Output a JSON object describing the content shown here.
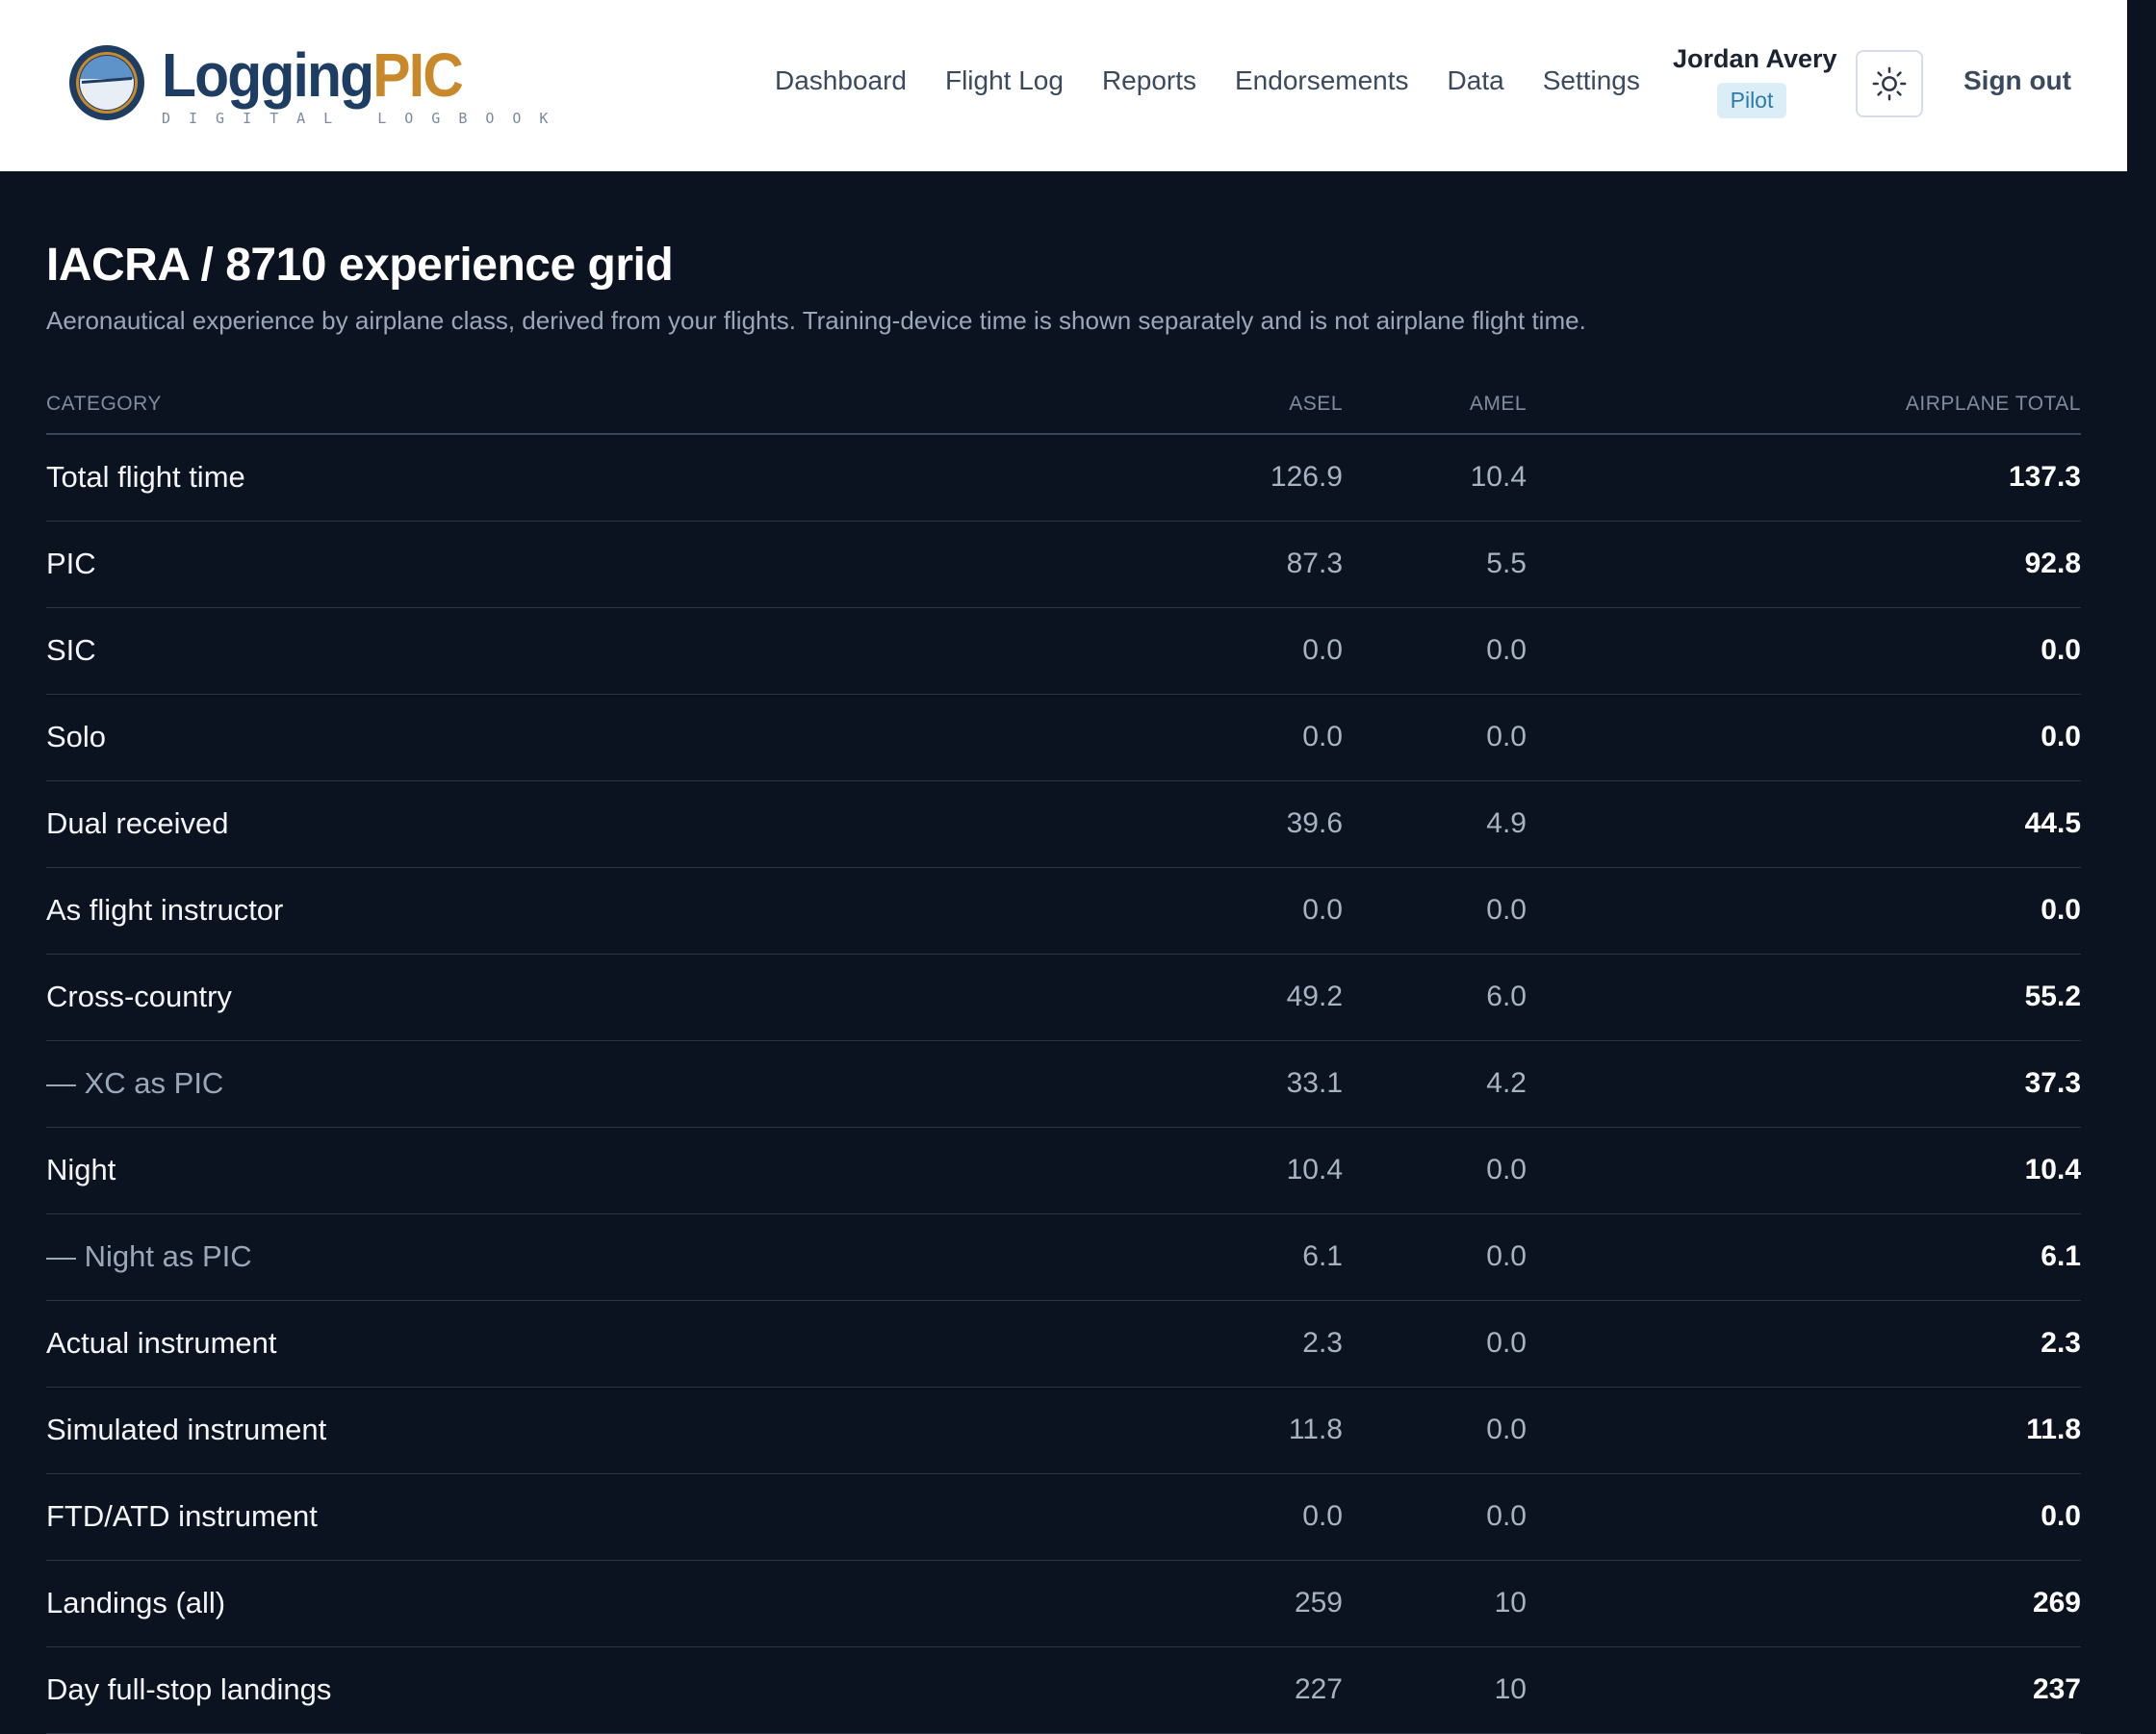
{
  "brand": {
    "word_primary": "Logging",
    "word_accent": "PIC",
    "tagline": "DIGITAL LOGBOOK",
    "colors": {
      "primary": "#1e3d63",
      "accent": "#c9892a"
    }
  },
  "nav": {
    "items": [
      {
        "label": "Dashboard"
      },
      {
        "label": "Flight Log"
      },
      {
        "label": "Reports"
      },
      {
        "label": "Endorsements"
      },
      {
        "label": "Data"
      },
      {
        "label": "Settings"
      }
    ]
  },
  "user": {
    "name": "Jordan Avery",
    "role": "Pilot"
  },
  "theme_toggle": {
    "icon": "sun-icon"
  },
  "sign_out_label": "Sign out",
  "page": {
    "title": "IACRA / 8710 experience grid",
    "subtitle": "Aeronautical experience by airplane class, derived from your flights. Training-device time is shown separately and is not airplane flight time."
  },
  "grid": {
    "headers": {
      "category": "CATEGORY",
      "asel": "ASEL",
      "amel": "AMEL",
      "total": "AIRPLANE TOTAL"
    },
    "rows": [
      {
        "label": "Total flight time",
        "asel": "126.9",
        "amel": "10.4",
        "total": "137.3",
        "sub": false
      },
      {
        "label": "PIC",
        "asel": "87.3",
        "amel": "5.5",
        "total": "92.8",
        "sub": false
      },
      {
        "label": "SIC",
        "asel": "0.0",
        "amel": "0.0",
        "total": "0.0",
        "sub": false
      },
      {
        "label": "Solo",
        "asel": "0.0",
        "amel": "0.0",
        "total": "0.0",
        "sub": false
      },
      {
        "label": "Dual received",
        "asel": "39.6",
        "amel": "4.9",
        "total": "44.5",
        "sub": false
      },
      {
        "label": "As flight instructor",
        "asel": "0.0",
        "amel": "0.0",
        "total": "0.0",
        "sub": false
      },
      {
        "label": "Cross-country",
        "asel": "49.2",
        "amel": "6.0",
        "total": "55.2",
        "sub": false
      },
      {
        "label": "— XC as PIC",
        "asel": "33.1",
        "amel": "4.2",
        "total": "37.3",
        "sub": true
      },
      {
        "label": "Night",
        "asel": "10.4",
        "amel": "0.0",
        "total": "10.4",
        "sub": false
      },
      {
        "label": "— Night as PIC",
        "asel": "6.1",
        "amel": "0.0",
        "total": "6.1",
        "sub": true
      },
      {
        "label": "Actual instrument",
        "asel": "2.3",
        "amel": "0.0",
        "total": "2.3",
        "sub": false
      },
      {
        "label": "Simulated instrument",
        "asel": "11.8",
        "amel": "0.0",
        "total": "11.8",
        "sub": false
      },
      {
        "label": "FTD/ATD instrument",
        "asel": "0.0",
        "amel": "0.0",
        "total": "0.0",
        "sub": false
      },
      {
        "label": "Landings (all)",
        "asel": "259",
        "amel": "10",
        "total": "269",
        "sub": false
      },
      {
        "label": "Day full-stop landings",
        "asel": "227",
        "amel": "10",
        "total": "237",
        "sub": false
      }
    ]
  }
}
